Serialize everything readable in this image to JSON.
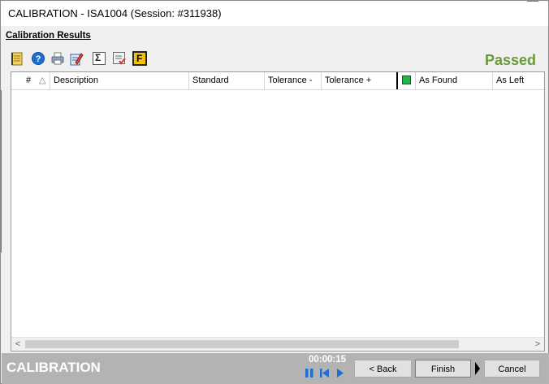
{
  "window": {
    "title": "CALIBRATION - ISA1004 (Session: #311938)"
  },
  "section_title": "Calibration Results",
  "toolbar": {
    "icons": [
      "notepad-icon",
      "help-icon",
      "print-icon",
      "edit-icon",
      "sum-icon",
      "checklist-icon",
      "f-icon"
    ],
    "f_label": "F",
    "sum_label": "Σ"
  },
  "status": {
    "text": "Passed",
    "color": "#6a9a3c"
  },
  "table": {
    "columns": [
      "#",
      "△",
      "Description",
      "Standard",
      "Tolerance -",
      "Tolerance +",
      "",
      "As Found",
      "As Left"
    ],
    "rows": []
  },
  "scroll": {
    "left": "<",
    "right": ">"
  },
  "footer": {
    "title": "CALIBRATION",
    "timer": "00:00:15",
    "back_label": "< Back",
    "finish_label": "Finish",
    "cancel_label": "Cancel"
  }
}
